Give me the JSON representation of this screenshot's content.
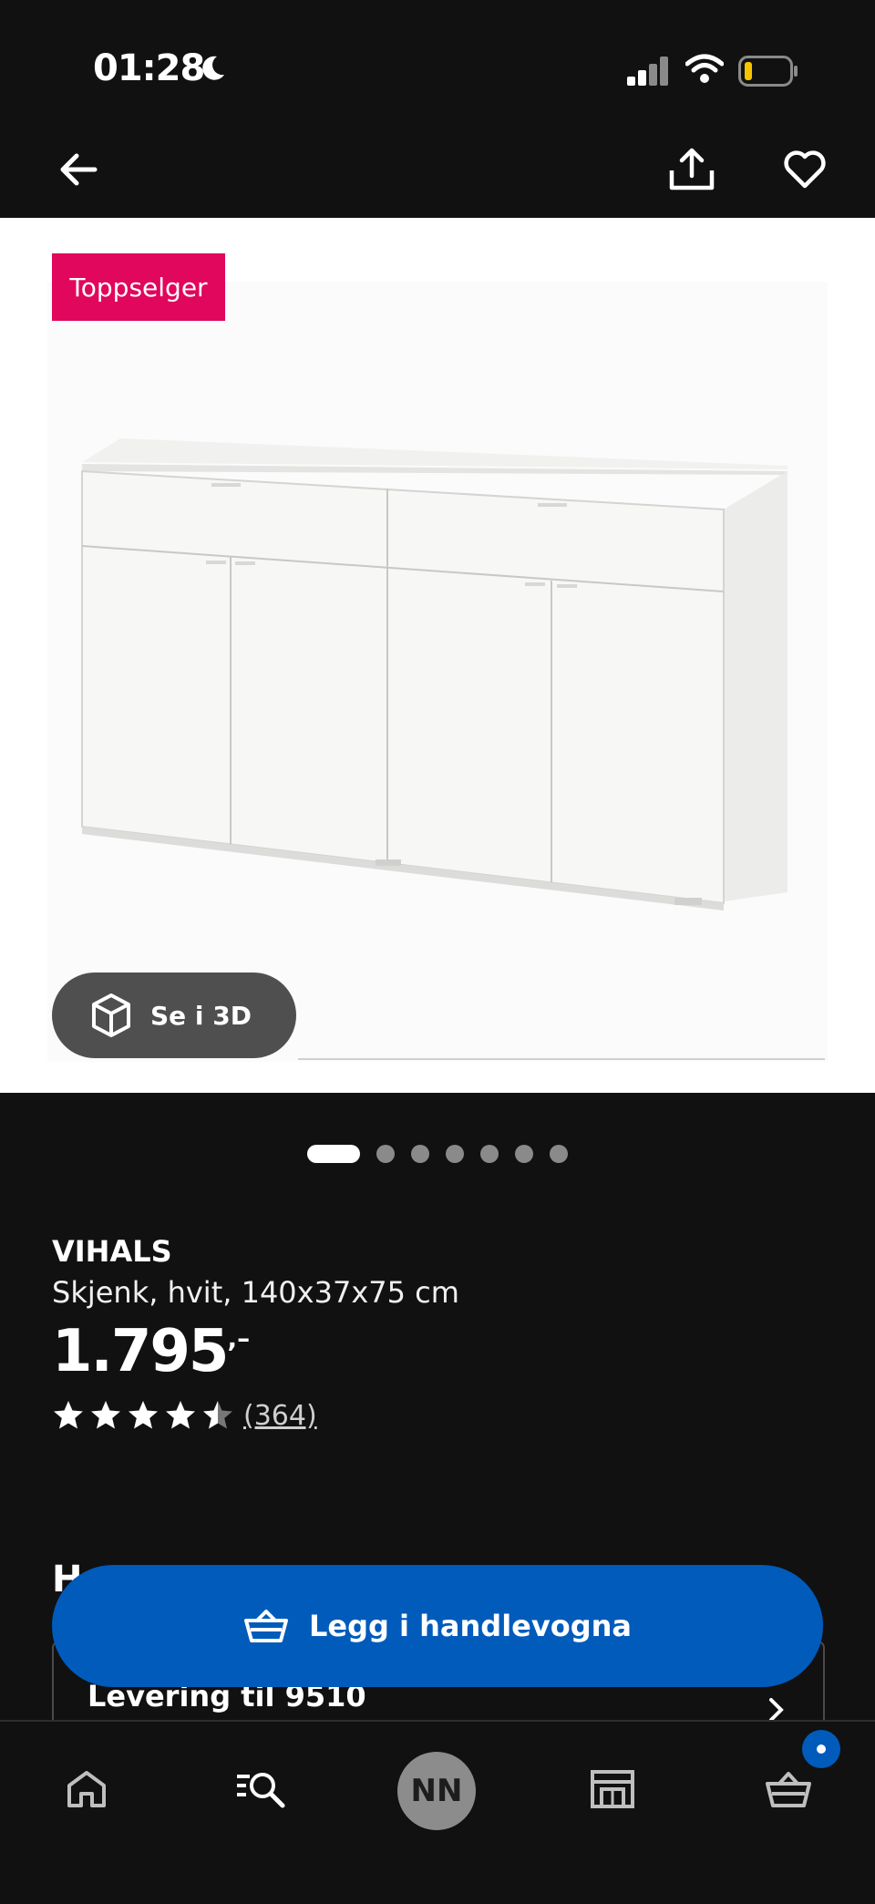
{
  "status_bar": {
    "time": "01:28",
    "battery_color": "#f5c400"
  },
  "top_nav": {
    "back_icon": "arrow-left-icon",
    "share_icon": "share-icon",
    "favorite_icon": "heart-icon"
  },
  "product_image": {
    "badge": "Toppselger",
    "see_3d_label": "Se i 3D",
    "carousel_count": 7,
    "carousel_active": 1
  },
  "product": {
    "brand": "VIHALS",
    "description": "Skjenk, hvit, 140x37x75 cm",
    "price": "1.795",
    "price_suffix": ",–",
    "rating": 4.5,
    "review_count": "(364)"
  },
  "section": {
    "heading": "H",
    "delivery": "Levering til 9510"
  },
  "cart_button": {
    "label": "Legg i handlevogna",
    "color": "#005bbb"
  },
  "bottom_nav": {
    "home_icon": "home-icon",
    "search_icon": "search-icon",
    "avatar_initials": "NN",
    "store_icon": "store-icon",
    "cart_icon": "cart-icon"
  }
}
